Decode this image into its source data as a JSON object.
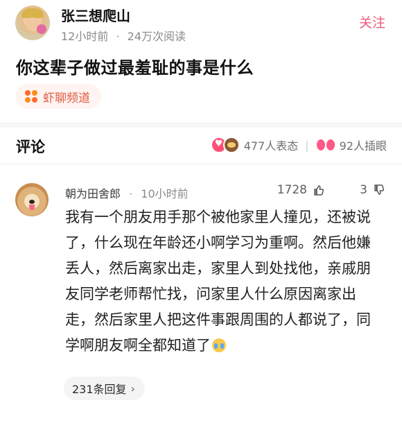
{
  "post": {
    "author": "张三想爬山",
    "time": "12小时前",
    "meta_separator": "·",
    "views": "24万次阅读",
    "follow_label": "关注",
    "title": "你这辈子做过最羞耻的事是什么",
    "channel_label": "虾聊频道"
  },
  "comments_section": {
    "title": "评论",
    "reactions_label": "477人表态",
    "separator": "|",
    "eyes_label": "92人插眼"
  },
  "comment": {
    "username": "朝为田舍郎",
    "meta_separator": "·",
    "time": "10小时前",
    "likes": "1728",
    "dislikes": "3",
    "text": "我有一个朋友用手那个被他家里人撞见，还被说了，什么现在年龄还小啊学习为重啊。然后他嫌丢人，然后离家出走，家里人到处找他，亲戚朋友同学老师帮忙找，问家里人什么原因离家出走，然后家里人把这件事跟周围的人都说了，同学啊朋友啊全都知道了",
    "replies_label": "231条回复",
    "replies_chevron": "›"
  },
  "colors": {
    "accent_pink": "#ef5a78",
    "channel_orange": "#e05c44",
    "muted_gray": "#8a8a8a"
  },
  "icons": {
    "channel": "channel-dots-icon",
    "heart": "heart-emoji-icon",
    "poop": "poop-emoji-icon",
    "eyes": "eyes-icon",
    "like": "thumbs-up-icon",
    "dislike": "thumbs-down-icon",
    "cry": "crying-emoji-icon",
    "chevron": "chevron-right-icon"
  }
}
